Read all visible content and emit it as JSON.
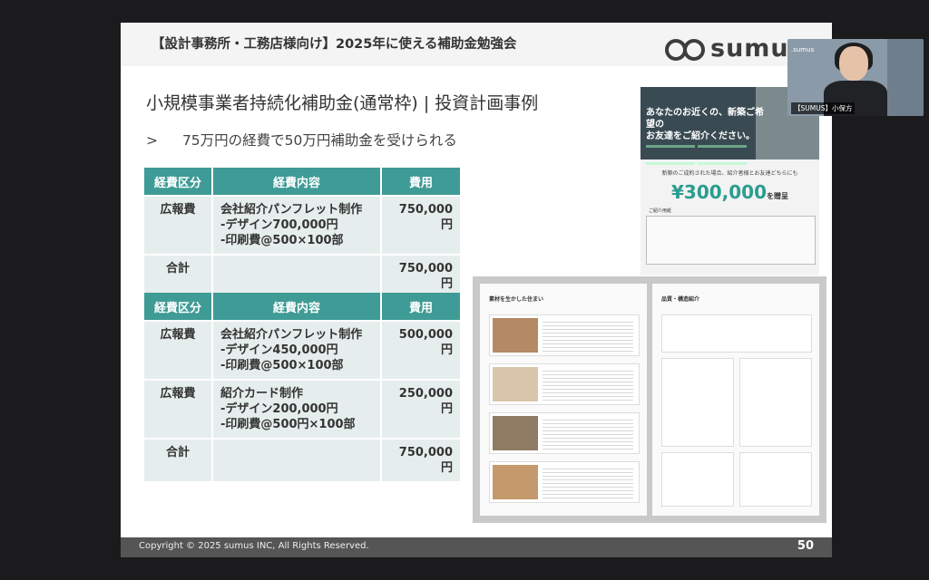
{
  "slide": {
    "header_title": "【設計事務所・工務店様向け】2025年に使える補助金勉強会",
    "logo_text": "sumus",
    "title": "小規模事業者持続化補助金(通常枠) | 投資計画事例",
    "subtitle_arrow": ">",
    "subtitle": "75万円の経費で50万円補助金を受けられる",
    "table_headers": {
      "category": "経費区分",
      "content": "経費内容",
      "cost": "費用"
    },
    "table1": {
      "rows": [
        {
          "category": "広報費",
          "line1": "会社紹介パンフレット制作",
          "line2": "-デザイン700,000円",
          "line3": "-印刷費@500×100部",
          "cost": "750,000円"
        },
        {
          "category": "合計",
          "cost": "750,000円"
        }
      ]
    },
    "table2": {
      "rows": [
        {
          "category": "広報費",
          "line1": "会社紹介パンフレット制作",
          "line2": "-デザイン450,000円",
          "line3": "-印刷費@500×100部",
          "cost": "500,000円"
        },
        {
          "category": "広報費",
          "line1": "紹介カード制作",
          "line2": "-デザイン200,000円",
          "line3": "-印刷費@500円×100部",
          "cost": "250,000円"
        },
        {
          "category": "合計",
          "cost": "750,000円"
        }
      ]
    },
    "flyer": {
      "headline_line1": "あなたのお近くの、新築ご希望の",
      "headline_line2": "お友達をご紹介ください。",
      "offer": "新築のご成約された場合、紹介者様とお友達どちらにも",
      "amount": "¥300,000",
      "amount_suffix": "を贈呈",
      "form_label": "ご紹介用紙"
    },
    "brochure": {
      "left_heading": "素材を生かした住まい",
      "right_heading": "品質・構造紹介"
    },
    "footer": {
      "copyright": "Copyright © 2025 sumus INC, All Rights Reserved.",
      "page_number": "50"
    }
  },
  "presenter": {
    "logo": ".sumus",
    "name_label": "【SUMUS】小保方"
  },
  "colors": {
    "table_header": "#3f9b96",
    "table_cell": "#e6eeed",
    "footer": "#555555",
    "background": "#1b1b1d"
  }
}
